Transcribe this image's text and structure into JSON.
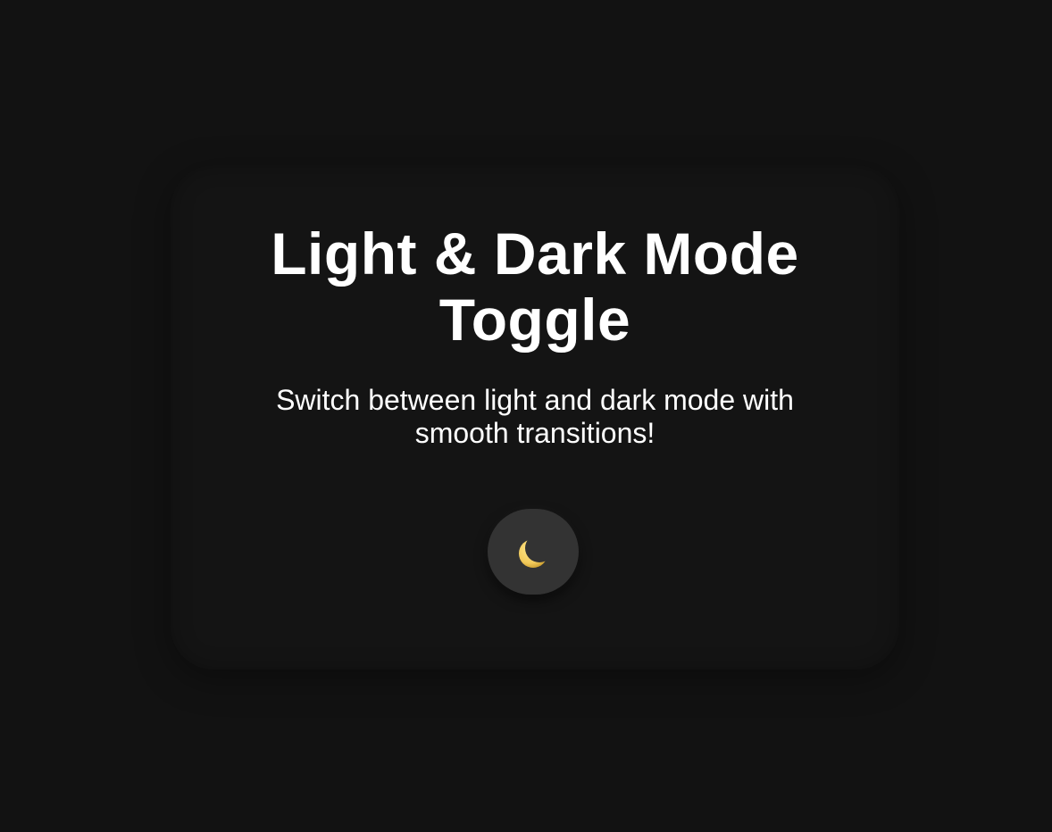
{
  "card": {
    "title": "Light & Dark Mode Toggle",
    "subtitle": "Switch between light and dark mode with smooth transitions!"
  },
  "toggle": {
    "icon": "moon-icon",
    "mode": "dark"
  },
  "colors": {
    "background": "#121212",
    "card": "#141414",
    "toggle_bg": "#333333",
    "moon": "#f3d36b",
    "text": "#ffffff"
  }
}
